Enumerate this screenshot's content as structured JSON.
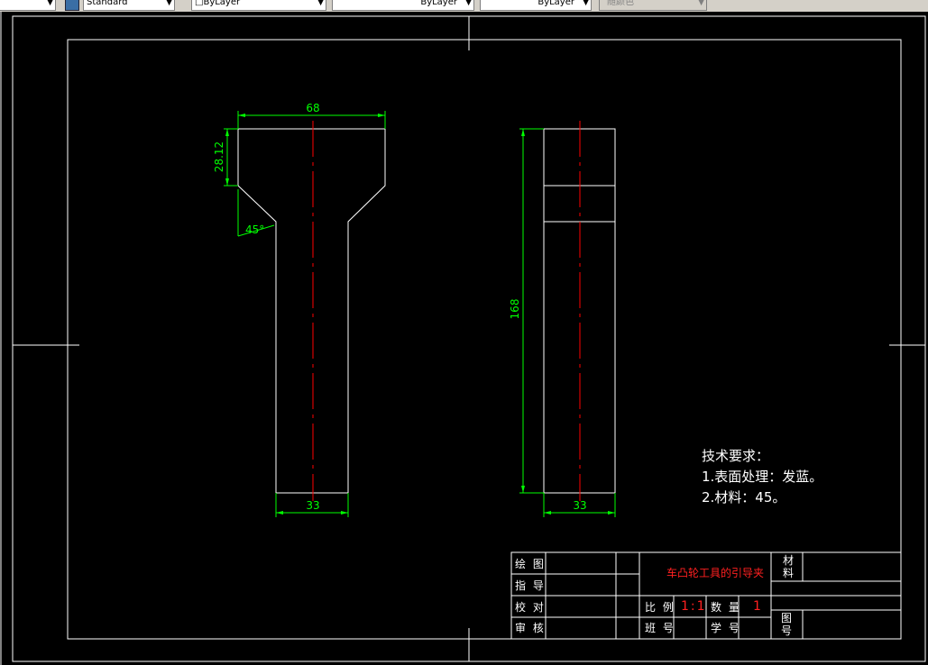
{
  "toolbar": {
    "text_style": "Standard",
    "layer_color": "ByLayer",
    "linetype": "ByLayer",
    "lineweight": "ByLayer",
    "plot_style": "随颜色"
  },
  "drawing": {
    "front_view": {
      "top_width": "68",
      "head_height": "28.12",
      "chamfer_angle": "45°",
      "stem_width": "33"
    },
    "side_view": {
      "height": "168",
      "width": "33"
    },
    "tech_requirements": {
      "title": "技术要求：",
      "items": [
        "1.表面处理：发蓝。",
        "2.材料：45。"
      ]
    },
    "title_block": {
      "part_name": "车凸轮工具的引导夹",
      "drawn_by": "绘 图",
      "instructor": "指 导",
      "checked": "校 对",
      "reviewed": "审 核",
      "scale_label": "比 例",
      "scale_value": "1:1",
      "quantity_label": "数 量",
      "quantity_value": "1",
      "class_label": "班 号",
      "student_no_label": "学 号",
      "material_label": "材\n料",
      "drawing_no_label": "图\n号"
    },
    "colors": {
      "outline": "#ffffff",
      "dimension": "#00ff00",
      "centerline": "#ff0000",
      "background": "#000000"
    }
  }
}
